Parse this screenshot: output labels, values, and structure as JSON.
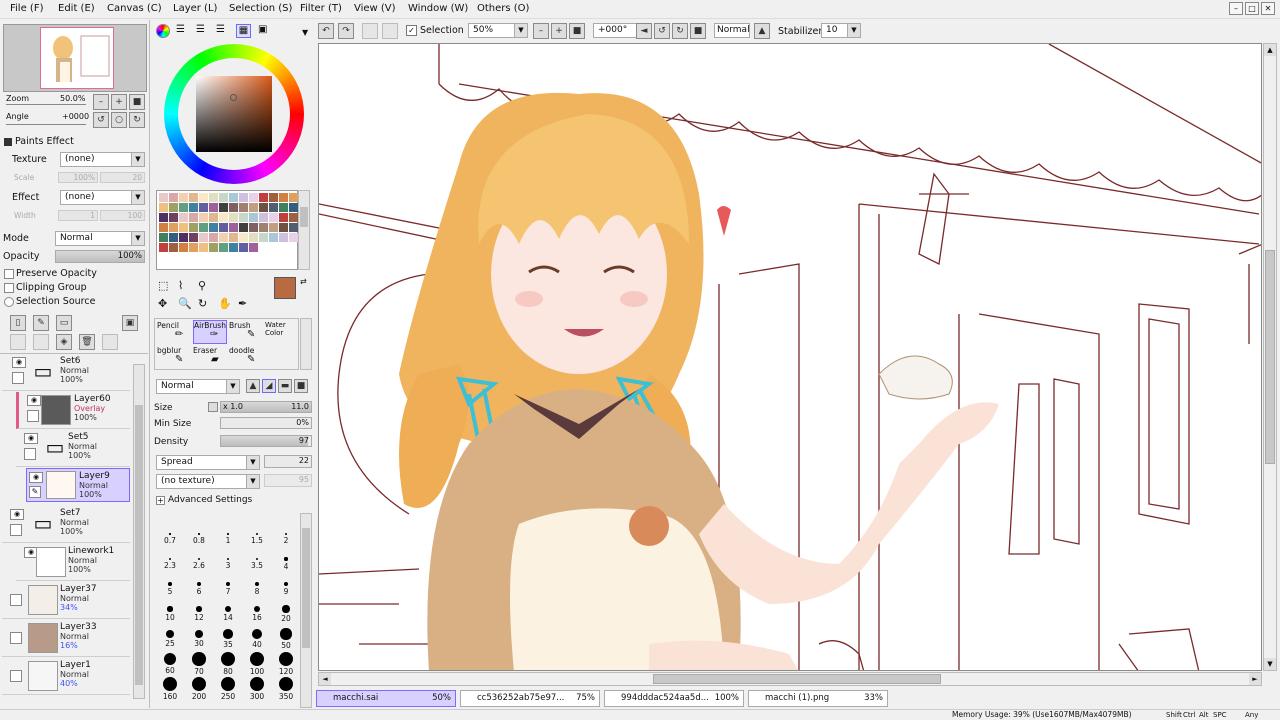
{
  "menu": [
    "File (F)",
    "Edit (E)",
    "Canvas (C)",
    "Layer (L)",
    "Selection (S)",
    "Filter (T)",
    "View (V)",
    "Window (W)",
    "Others (O)"
  ],
  "toolbar": {
    "selection_label": "Selection",
    "zoom_value": "50%",
    "rotate_value": "+000°",
    "blend_value": "Normal",
    "stabilizer_label": "Stabilizer",
    "stabilizer_value": "10"
  },
  "navigator": {
    "zoom_label": "Zoom",
    "zoom_value": "50.0%",
    "angle_label": "Angle",
    "angle_value": "+0000"
  },
  "paints_effect": {
    "title": "Paints Effect",
    "texture_label": "Texture",
    "texture_value": "(none)",
    "scale_label": "Scale",
    "scale_value": "100%",
    "scale_num": "20",
    "effect_label": "Effect",
    "effect_value": "(none)",
    "width_label": "Width",
    "width_value": "1",
    "width_num": "100"
  },
  "layer_props": {
    "mode_label": "Mode",
    "mode_value": "Normal",
    "opacity_label": "Opacity",
    "opacity_value": "100%",
    "opacity_fraction": 1.0,
    "preserve_opacity": "Preserve Opacity",
    "clipping_group": "Clipping Group",
    "selection_source": "Selection Source"
  },
  "layers": [
    {
      "name": "Set6",
      "mode": "Normal",
      "opacity": "100%",
      "type": "folder"
    },
    {
      "name": "Layer60",
      "mode": "Overlay",
      "opacity": "100%",
      "type": "layer"
    },
    {
      "name": "Set5",
      "mode": "Normal",
      "opacity": "100%",
      "type": "folder"
    },
    {
      "name": "Layer9",
      "mode": "Normal",
      "opacity": "100%",
      "type": "layer",
      "selected": true
    },
    {
      "name": "Set7",
      "mode": "Normal",
      "opacity": "100%",
      "type": "folder"
    },
    {
      "name": "Linework1",
      "mode": "Normal",
      "opacity": "100%",
      "type": "layer"
    },
    {
      "name": "Layer37",
      "mode": "Normal",
      "opacity": "34%",
      "type": "layer"
    },
    {
      "name": "Layer33",
      "mode": "Normal",
      "opacity": "16%",
      "type": "layer"
    },
    {
      "name": "Layer1",
      "mode": "Normal",
      "opacity": "40%",
      "type": "layer"
    }
  ],
  "tools": {
    "row1": [
      "Pencil",
      "AirBrush",
      "Brush",
      "Water Color"
    ],
    "row2": [
      "bgblur",
      "Eraser",
      "doodle"
    ]
  },
  "brush": {
    "blend": "Normal",
    "size_label": "Size",
    "size_mult": "x 1.0",
    "size_value": "11.0",
    "minsize_label": "Min Size",
    "minsize_value": "0%",
    "density_label": "Density",
    "density_value": "97",
    "density_fraction": 0.97,
    "spread_label": "Spread",
    "spread_value": "22",
    "texture_value": "(no texture)",
    "texture_num": "95",
    "advanced": "Advanced Settings"
  },
  "brush_sizes": [
    "0.7",
    "0.8",
    "1",
    "1.5",
    "2",
    "2.3",
    "2.6",
    "3",
    "3.5",
    "4",
    "5",
    "6",
    "7",
    "8",
    "9",
    "10",
    "12",
    "14",
    "16",
    "20",
    "25",
    "30",
    "35",
    "40",
    "50",
    "60",
    "70",
    "80",
    "100",
    "120",
    "160",
    "200",
    "250",
    "300",
    "350"
  ],
  "colors": {
    "current": "#b86a43",
    "secondary": "#ffffff",
    "accent": "#7a6cff"
  },
  "tasks": [
    {
      "name": "macchi.sai",
      "pct": "50%"
    },
    {
      "name": "cc536252ab75e97...",
      "pct": "75%"
    },
    {
      "name": "994dddac524aa5d...",
      "pct": "100%"
    },
    {
      "name": "macchi (1).png",
      "pct": "33%"
    }
  ],
  "status": {
    "memory": "Memory Usage: 39% (Use1607MB/Max4079MB)",
    "keys": [
      "Shift",
      "Ctrl",
      "Alt",
      "SPC",
      "Any"
    ]
  }
}
